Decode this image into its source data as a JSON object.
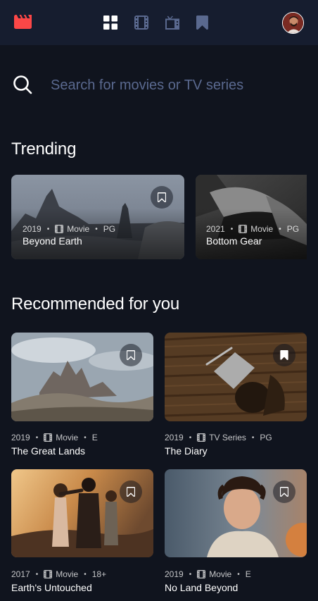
{
  "search": {
    "placeholder": "Search for movies or TV series"
  },
  "sections": {
    "trending": "Trending",
    "recommended": "Recommended for you"
  },
  "colors": {
    "background": "#10141E",
    "topbar": "#161D2F",
    "accent": "#FC4747",
    "nav_inactive": "#5A698F",
    "muted_text": "#5A698F"
  },
  "nav": {
    "logo_icon": "film-clapper-icon",
    "items": [
      {
        "icon": "grid-icon",
        "active": true
      },
      {
        "icon": "film-icon",
        "active": false
      },
      {
        "icon": "tv-icon",
        "active": false
      },
      {
        "icon": "bookmark-icon",
        "active": false
      }
    ]
  },
  "trending": [
    {
      "year": "2019",
      "category": "Movie",
      "rating": "PG",
      "title": "Beyond Earth",
      "bookmarked": false
    },
    {
      "year": "2021",
      "category": "Movie",
      "rating": "PG",
      "title": "Bottom Gear",
      "bookmarked": false
    }
  ],
  "recommended": [
    {
      "year": "2019",
      "category": "Movie",
      "rating": "E",
      "title": "The Great Lands",
      "bookmarked": false
    },
    {
      "year": "2019",
      "category": "TV Series",
      "rating": "PG",
      "title": "The Diary",
      "bookmarked": true
    },
    {
      "year": "2017",
      "category": "Movie",
      "rating": "18+",
      "title": "Earth's Untouched",
      "bookmarked": false
    },
    {
      "year": "2019",
      "category": "Movie",
      "rating": "E",
      "title": "No Land Beyond",
      "bookmarked": false
    }
  ]
}
